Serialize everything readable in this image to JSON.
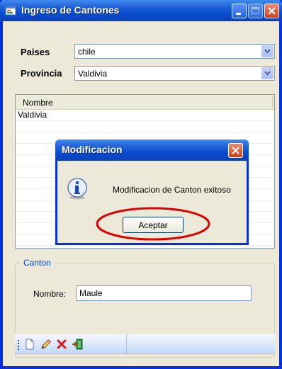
{
  "window": {
    "title": "Ingreso de Cantones"
  },
  "filters": {
    "paises_label": "Paises",
    "paises_value": "chile",
    "provincia_label": "Provincia",
    "provincia_value": "Valdivia"
  },
  "grid": {
    "header": "Nombre",
    "rows": [
      "Valdivia"
    ]
  },
  "group": {
    "title": "Canton",
    "nombre_label": "Nombre:",
    "nombre_value": "Maule"
  },
  "toolbar": {
    "icons": [
      "new-document-icon",
      "edit-pencil-icon",
      "delete-x-icon",
      "exit-door-icon"
    ]
  },
  "dialog": {
    "title": "Modificacion",
    "message": "Modificacion de Canton exitoso",
    "button_label": "Aceptar",
    "icon": "info-icon"
  },
  "annotation": {
    "color": "#e00000"
  }
}
